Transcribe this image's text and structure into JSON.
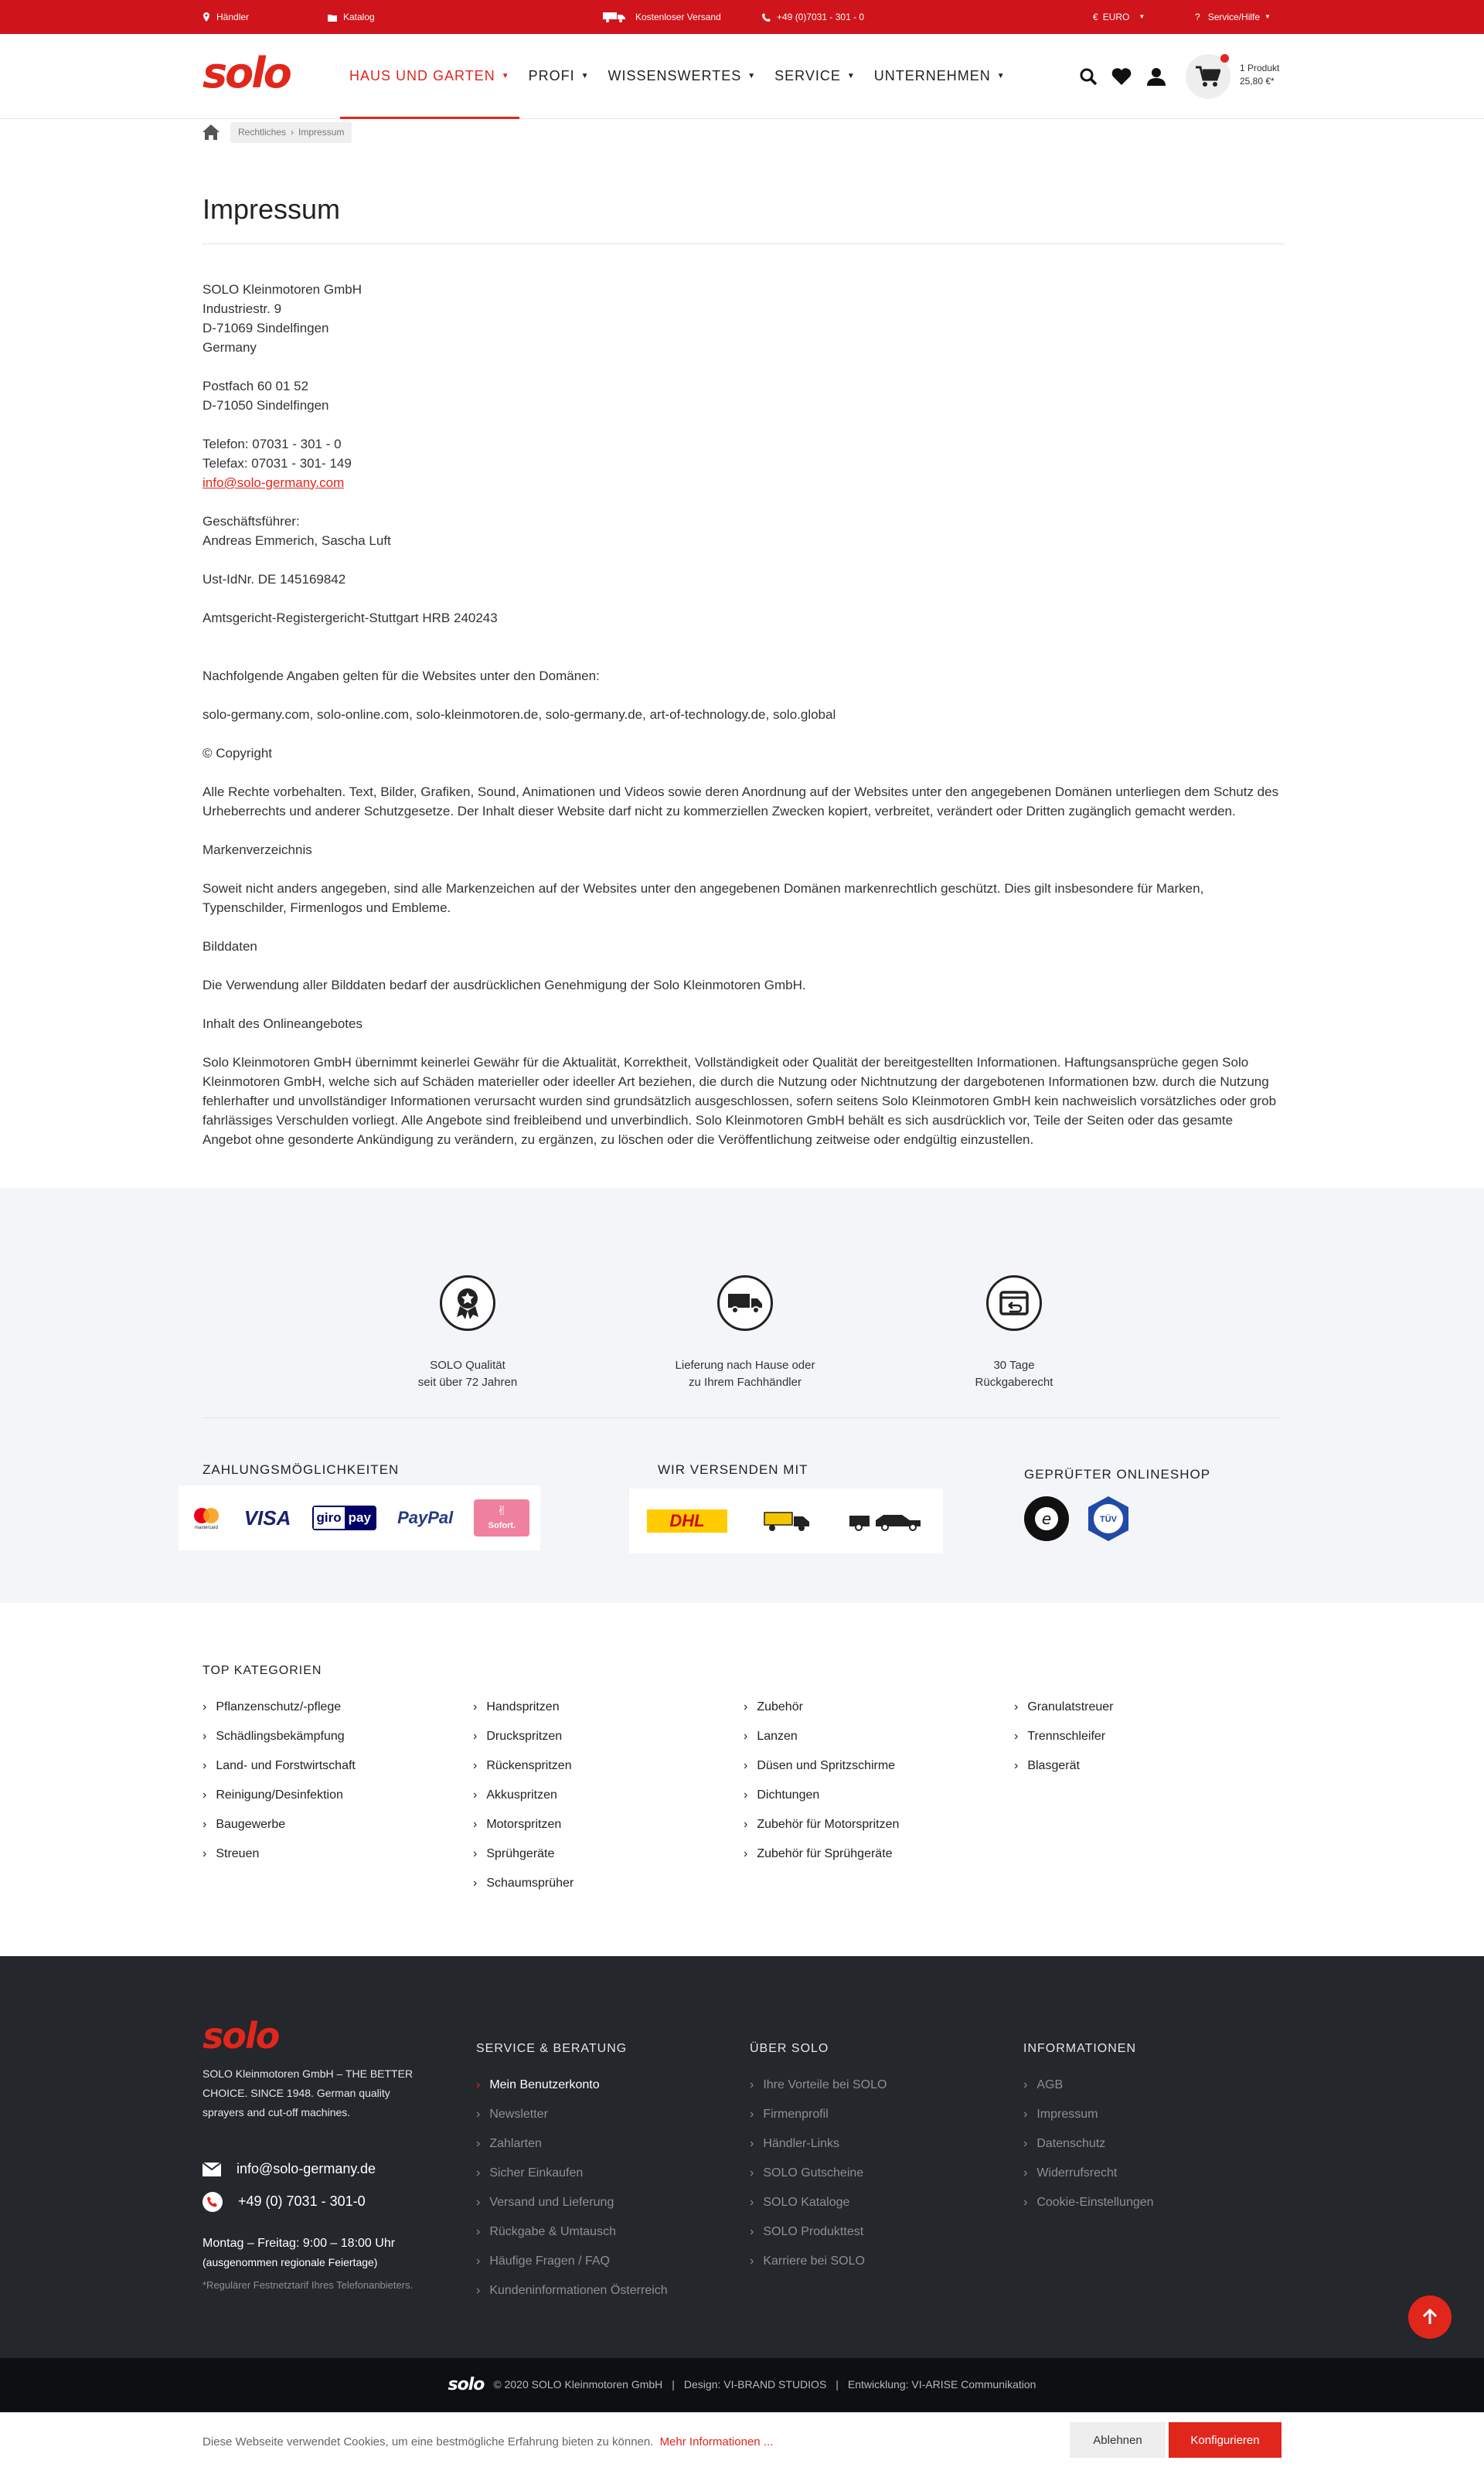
{
  "topbar": {
    "dealer": "Händler",
    "catalog": "Katalog",
    "shipping": "Kostenloser Versand",
    "phone": "+49 (0)7031 - 301 - 0",
    "currency": "EURO",
    "currency_symbol": "€",
    "help": "Service/Hilfe"
  },
  "header": {
    "logo": "solo",
    "nav": [
      {
        "label": "Haus und Garten"
      },
      {
        "label": "Profi"
      },
      {
        "label": "Wissenswertes"
      },
      {
        "label": "Service"
      },
      {
        "label": "Unternehmen"
      }
    ],
    "cart_count": "1 Produkt",
    "cart_total": "25,80 €*"
  },
  "breadcrumb": {
    "items": [
      "Rechtliches",
      "Impressum"
    ]
  },
  "page": {
    "title": "Impressum",
    "paragraphs": [
      "SOLO Kleinmotoren GmbH\nIndustriestr. 9\nD-71069 Sindelfingen\nGermany",
      "Postfach 60 01 52\nD-71050 Sindelfingen",
      "Telefon: 07031 - 301 - 0\nTelefax: 07031 - 301- 149",
      "Geschäftsführer:\nAndreas Emmerich, Sascha Luft",
      "Ust-IdNr. DE 145169842",
      "Amtsgericht-Registergericht-Stuttgart HRB 240243",
      "Nachfolgende Angaben gelten für die Websites unter den Domänen:",
      "solo-germany.com, solo-online.com, solo-kleinmotoren.de, solo-germany.de, art-of-technology.de, solo.global",
      "© Copyright",
      "Alle Rechte vorbehalten. Text, Bilder, Grafiken, Sound, Animationen und Videos sowie deren Anordnung auf der Websites unter den angegebenen Domänen unterliegen dem Schutz des Urheberrechts und anderer Schutzgesetze. Der Inhalt dieser Website darf nicht zu kommerziellen Zwecken kopiert, verbreitet, verändert oder Dritten zugänglich gemacht werden.",
      "Markenverzeichnis",
      "Soweit nicht anders angegeben, sind alle Markenzeichen auf der Websites unter den angegebenen Domänen markenrechtlich geschützt. Dies gilt insbesondere für Marken, Typenschilder, Firmenlogos und Embleme.",
      "Bilddaten",
      "Die Verwendung aller Bilddaten bedarf der ausdrücklichen Genehmigung der Solo Kleinmotoren GmbH.",
      "Inhalt des Onlineangebotes",
      "Solo Kleinmotoren GmbH übernimmt keinerlei Gewähr für die Aktualität, Korrektheit, Vollständigkeit oder Qualität der bereitgestellten Informationen. Haftungsansprüche gegen Solo Kleinmotoren GmbH, welche sich auf Schäden materieller oder ideeller Art beziehen, die durch die Nutzung oder Nichtnutzung der dargebotenen Informationen bzw. durch die Nutzung fehlerhafter und unvollständiger Informationen verursacht wurden sind grundsätzlich ausgeschlossen, sofern seitens Solo Kleinmotoren GmbH kein nachweislich vorsätzliches oder grob fahrlässiges Verschulden vorliegt. Alle Angebote sind freibleibend und unverbindlich. Solo Kleinmotoren GmbH behält es sich ausdrücklich vor, Teile der Seiten oder das gesamte Angebot ohne gesonderte Ankündigung zu verändern, zu ergänzen, zu löschen oder die Veröffentlichung zeitweise oder endgültig einzustellen."
    ],
    "email": "info@solo-germany.com"
  },
  "features": [
    {
      "line1": "SOLO Qualität",
      "line2": "seit über 72 Jahren"
    },
    {
      "line1": "Lieferung nach Hause oder",
      "line2": "zu Ihrem Fachhändler"
    },
    {
      "line1": "30 Tage",
      "line2": "Rückgaberecht"
    }
  ],
  "trust": {
    "payment_title": "Zahlungsmöglichkeiten",
    "shipping_title": "Wir versenden mit",
    "shop_title": "Geprüfter Onlineshop",
    "payment": [
      "mastercard",
      "VISA",
      "giro",
      "pay",
      "PayPal",
      "Sofort."
    ],
    "shipping": [
      "DHL"
    ]
  },
  "topcat": {
    "title": "TOP KATEGORIEN",
    "columns": [
      [
        "Pflanzenschutz/-pflege",
        "Schädlingsbekämpfung",
        "Land- und Forstwirtschaft",
        "Reinigung/Desinfektion",
        "Baugewerbe",
        "Streuen"
      ],
      [
        "Handspritzen",
        "Druckspritzen",
        "Rückenspritzen",
        "Akkuspritzen",
        "Motorspritzen",
        "Sprühgeräte",
        "Schaumsprüher"
      ],
      [
        "Zubehör",
        "Lanzen",
        "Düsen und Spritzschirme",
        "Dichtungen",
        "Zubehör für Motorspritzen",
        "Zubehör für Sprühgeräte"
      ],
      [
        "Granulatstreuer",
        "Trennschleifer",
        "Blasgerät"
      ]
    ]
  },
  "footer": {
    "logo": "solo",
    "about": "SOLO Kleinmotoren GmbH – THE BETTER CHOICE. SINCE 1948. German quality sprayers and cut-off machines.",
    "email": "info@solo-germany.de",
    "phone": "+49 (0) 7031 - 301-0",
    "hours": "Montag – Freitag: 9:00 – 18:00 Uhr",
    "hours_note": "(ausgenommen regionale Feiertage)",
    "tariff": "*Regulärer Festnetztarif Ihres Telefonanbieters.",
    "columns": [
      {
        "title": "Service & Beratung",
        "items": [
          "Mein Benutzerkonto",
          "Newsletter",
          "Zahlarten",
          "Sicher Einkaufen",
          "Versand und Lieferung",
          "Rückgabe & Umtausch",
          "Häufige Fragen / FAQ",
          "Kundeninformationen Österreich"
        ]
      },
      {
        "title": "Über SOLO",
        "items": [
          "Ihre Vorteile bei SOLO",
          "Firmenprofil",
          "Händler-Links",
          "SOLO Gutscheine",
          "SOLO Kataloge",
          "SOLO Produkttest",
          "Karriere bei SOLO"
        ]
      },
      {
        "title": "Informationen",
        "items": [
          "AGB",
          "Impressum",
          "Datenschutz",
          "Widerrufsrecht",
          "Cookie-Einstellungen"
        ]
      }
    ]
  },
  "bottom": {
    "logo": "solo",
    "copyright": "© 2020 SOLO Kleinmotoren GmbH",
    "design": "Design: VI-BRAND STUDIOS",
    "dev": "Entwicklung: VI-ARISE Communikation",
    "sep": "|"
  },
  "cookie": {
    "text": "Diese Webseite verwendet Cookies, um eine bestmögliche Erfahrung bieten zu können.",
    "link": "Mehr Informationen ...",
    "decline": "Ablehnen",
    "configure": "Konfigurieren"
  },
  "colors": {
    "brand": "#e1261c",
    "topbar": "#d0141b",
    "footer": "#24272c"
  }
}
